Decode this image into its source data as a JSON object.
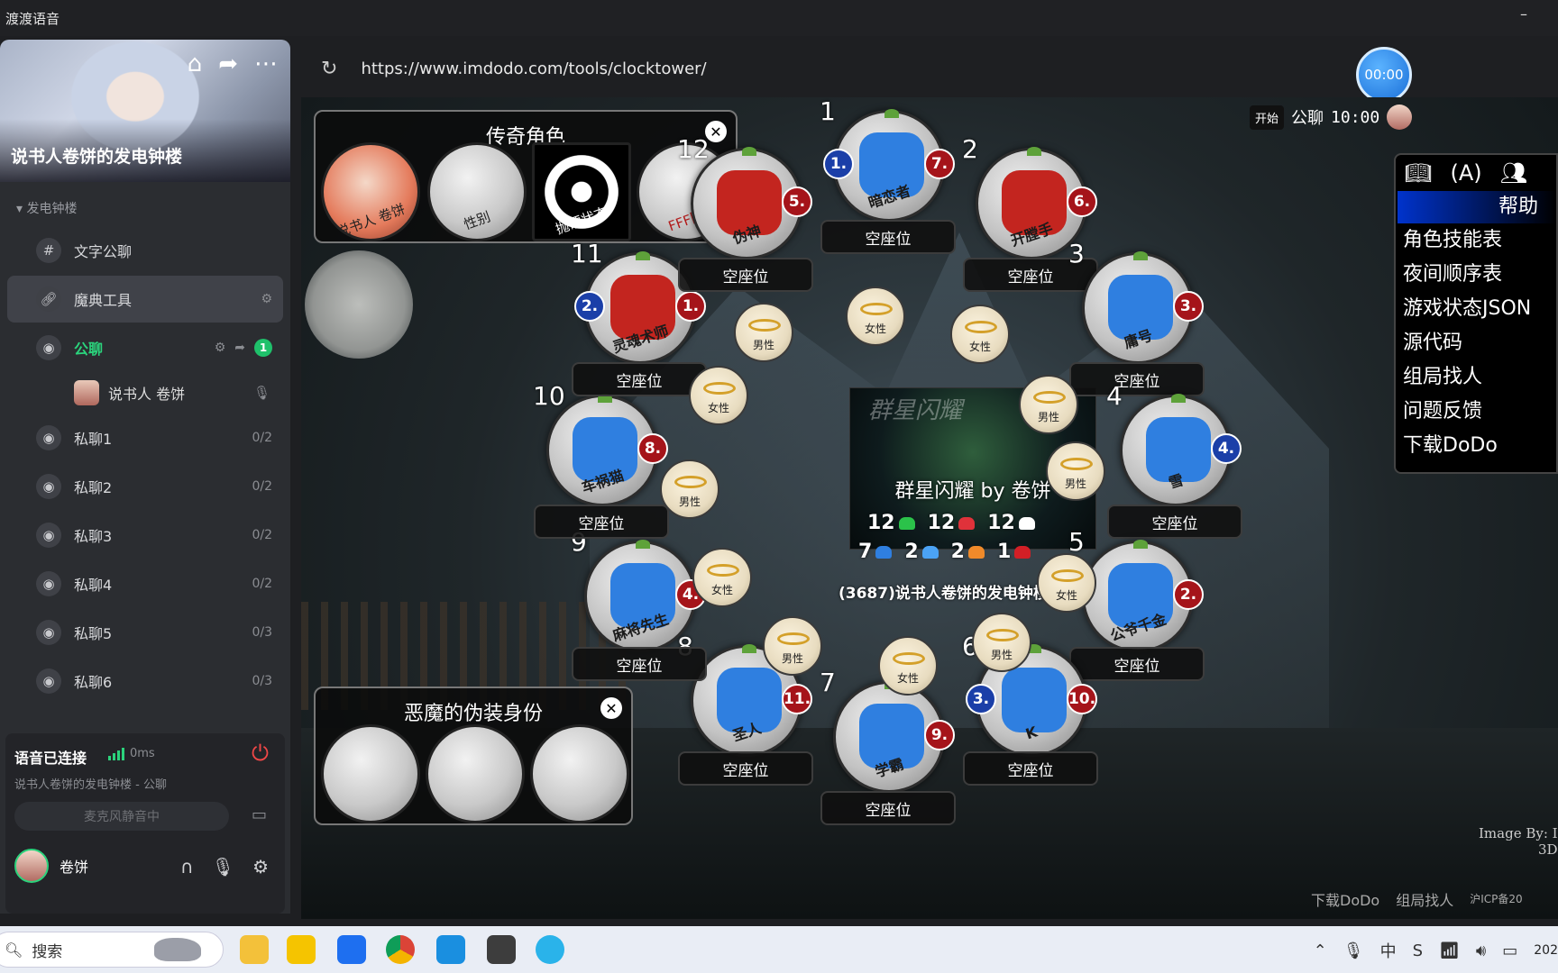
{
  "window": {
    "title": "渡渡语音",
    "minimize": "–"
  },
  "sidebar": {
    "server_name": "说书人卷饼的发电钟楼",
    "banner_icons": [
      "home-icon",
      "share-icon",
      "more-icon"
    ],
    "group_name": "发电钟楼",
    "channels": [
      {
        "label": "文字公聊",
        "icon": "#"
      },
      {
        "label": "魔典工具",
        "icon": "link"
      },
      {
        "label": "公聊",
        "icon": "voice",
        "badge": "1"
      }
    ],
    "member": {
      "name": "说书人 卷饼"
    },
    "private_channels": [
      {
        "label": "私聊1",
        "count": "0/2"
      },
      {
        "label": "私聊2",
        "count": "0/2"
      },
      {
        "label": "私聊3",
        "count": "0/2"
      },
      {
        "label": "私聊4",
        "count": "0/2"
      },
      {
        "label": "私聊5",
        "count": "0/3"
      },
      {
        "label": "私聊6",
        "count": "0/3"
      }
    ],
    "voice": {
      "status": "语音已连接",
      "ping": "0ms",
      "location": "说书人卷饼的发电钟楼 - 公聊",
      "mic_button": "麦克风静音中",
      "user_name": "卷饼"
    }
  },
  "browser": {
    "url": "https://www.imdodo.com/tools/clocktower/"
  },
  "timer": "00:00",
  "topbar": {
    "start": "开始",
    "channel": "公聊",
    "time": "10:00"
  },
  "legend_panel": {
    "title": "传奇角色",
    "tokens": [
      "说书人 卷饼",
      "性别",
      "抛硬状态",
      "FFF团"
    ]
  },
  "demon_panel": {
    "title": "恶魔的伪装身份"
  },
  "center": {
    "faint_text": "群星闪耀",
    "script_title": "群星闪耀 by 卷饼",
    "stats_row1": [
      "12",
      "12",
      "12"
    ],
    "stats_row2": [
      "7",
      "2",
      "2",
      "1"
    ],
    "channel_line": "(3687)说书人卷饼的发电钟楼 - 公"
  },
  "seats": [
    {
      "num": "1",
      "role": "暗恋者",
      "color": "blue",
      "orders": [
        {
          "v": "1.",
          "c": "blue"
        },
        {
          "v": "7.",
          "c": "red"
        }
      ],
      "plate": "空座位"
    },
    {
      "num": "2",
      "role": "开膛手",
      "color": "red",
      "orders": [
        {
          "v": "6.",
          "c": "red"
        }
      ],
      "plate": "空座位"
    },
    {
      "num": "3",
      "role": "庸号",
      "color": "blue",
      "orders": [
        {
          "v": "3.",
          "c": "red"
        }
      ],
      "plate": "空座位"
    },
    {
      "num": "4",
      "role": "雪",
      "color": "blue",
      "orders": [
        {
          "v": "4.",
          "c": "blue"
        }
      ],
      "plate": "空座位"
    },
    {
      "num": "5",
      "role": "公爷千金",
      "color": "blue",
      "orders": [
        {
          "v": "2.",
          "c": "red"
        }
      ],
      "plate": "空座位"
    },
    {
      "num": "6",
      "role": "K",
      "color": "blue",
      "orders": [
        {
          "v": "3.",
          "c": "blue"
        },
        {
          "v": "10.",
          "c": "red"
        }
      ],
      "plate": "空座位"
    },
    {
      "num": "7",
      "role": "学霸",
      "color": "blue",
      "orders": [
        {
          "v": "9.",
          "c": "red"
        }
      ],
      "plate": "空座位"
    },
    {
      "num": "8",
      "role": "圣人",
      "color": "blue",
      "orders": [
        {
          "v": "11.",
          "c": "red"
        }
      ],
      "plate": "空座位"
    },
    {
      "num": "9",
      "role": "麻将先生",
      "color": "blue",
      "orders": [
        {
          "v": "4.",
          "c": "red"
        }
      ],
      "plate": "空座位"
    },
    {
      "num": "10",
      "role": "车祸猫",
      "color": "blue",
      "orders": [
        {
          "v": "8.",
          "c": "red"
        }
      ],
      "plate": "空座位"
    },
    {
      "num": "11",
      "role": "灵魂术师",
      "color": "red",
      "orders": [
        {
          "v": "2.",
          "c": "blue"
        },
        {
          "v": "1.",
          "c": "red"
        }
      ],
      "plate": "空座位"
    },
    {
      "num": "12",
      "role": "伪神",
      "color": "red",
      "orders": [
        {
          "v": "5.",
          "c": "red"
        }
      ],
      "plate": "空座位"
    }
  ],
  "reminders": [
    "女性",
    "女性",
    "男性",
    "男性",
    "男性",
    "女性",
    "女性",
    "男性",
    "女性",
    "男性",
    "男性",
    "女性",
    "男性"
  ],
  "menu": {
    "help": "帮助",
    "items": [
      "角色技能表",
      "夜间顺序表",
      "游戏状态JSON",
      "源代码",
      "组局找人",
      "问题反馈",
      "下载DoDo"
    ]
  },
  "footer": {
    "links": [
      "下载DoDo",
      "组局找人"
    ],
    "icp": "沪ICP备20",
    "credit_line1": "Image By: I",
    "credit_line2": "3D"
  },
  "taskbar": {
    "search": "搜索",
    "year": "202"
  },
  "colors": {
    "accent_green": "#1fc16b",
    "order_red": "#a5141a",
    "order_blue": "#1b3fa8",
    "menu_blue": "#0033cc"
  }
}
